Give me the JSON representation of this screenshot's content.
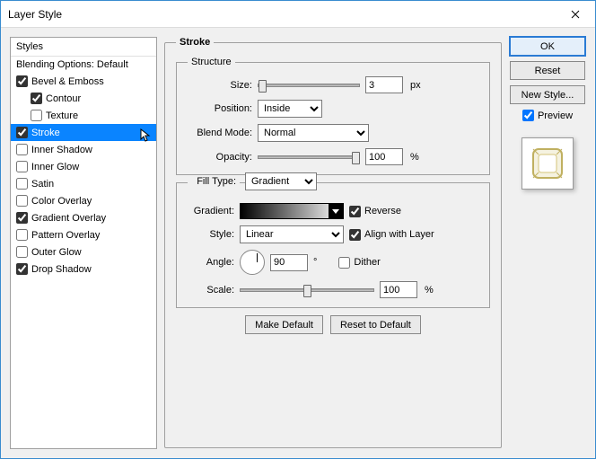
{
  "window": {
    "title": "Layer Style"
  },
  "sidebar": {
    "header": "Styles",
    "blending": "Blending Options: Default",
    "items": [
      {
        "label": "Bevel & Emboss",
        "checked": true
      },
      {
        "label": "Contour",
        "checked": true,
        "indent": true
      },
      {
        "label": "Texture",
        "checked": false,
        "indent": true
      },
      {
        "label": "Stroke",
        "checked": true,
        "selected": true
      },
      {
        "label": "Inner Shadow",
        "checked": false
      },
      {
        "label": "Inner Glow",
        "checked": false
      },
      {
        "label": "Satin",
        "checked": false
      },
      {
        "label": "Color Overlay",
        "checked": false
      },
      {
        "label": "Gradient Overlay",
        "checked": true
      },
      {
        "label": "Pattern Overlay",
        "checked": false
      },
      {
        "label": "Outer Glow",
        "checked": false
      },
      {
        "label": "Drop Shadow",
        "checked": true
      }
    ]
  },
  "panel": {
    "title": "Stroke",
    "structure": {
      "legend": "Structure",
      "size_label": "Size:",
      "size_value": "3",
      "size_unit": "px",
      "position_label": "Position:",
      "position_value": "Inside",
      "blend_label": "Blend Mode:",
      "blend_value": "Normal",
      "opacity_label": "Opacity:",
      "opacity_value": "100",
      "opacity_unit": "%"
    },
    "fill": {
      "type_label": "Fill Type:",
      "type_value": "Gradient",
      "gradient_label": "Gradient:",
      "reverse_label": "Reverse",
      "reverse_checked": true,
      "style_label": "Style:",
      "style_value": "Linear",
      "align_label": "Align with Layer",
      "align_checked": true,
      "angle_label": "Angle:",
      "angle_value": "90",
      "angle_unit": "°",
      "dither_label": "Dither",
      "dither_checked": false,
      "scale_label": "Scale:",
      "scale_value": "100",
      "scale_unit": "%"
    },
    "buttons": {
      "make_default": "Make Default",
      "reset_default": "Reset to Default"
    }
  },
  "right": {
    "ok": "OK",
    "reset": "Reset",
    "new_style": "New Style...",
    "preview": "Preview"
  }
}
